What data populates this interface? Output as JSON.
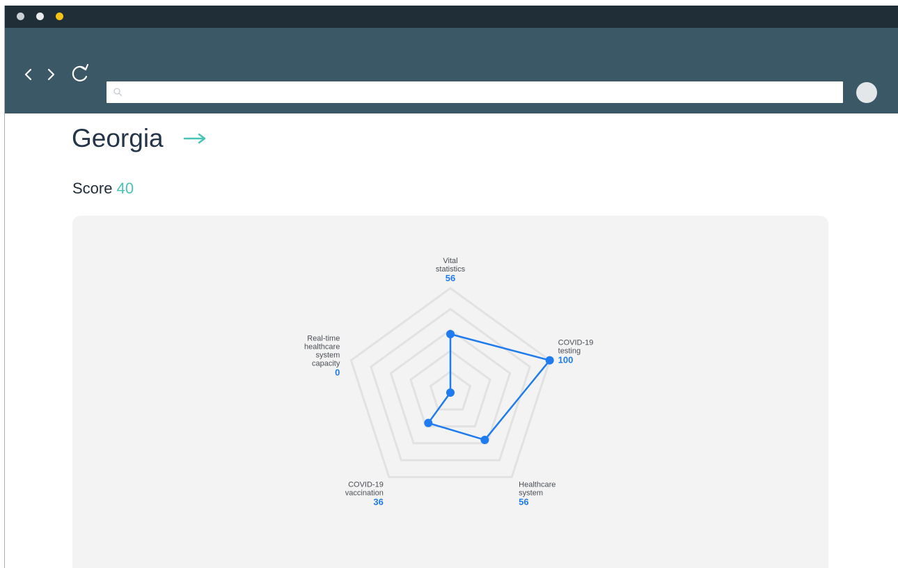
{
  "browser": {
    "window_dots": [
      {
        "color": "#c9cfd2"
      },
      {
        "color": "#e8ecee"
      },
      {
        "color": "#f6c218"
      }
    ],
    "nav": {
      "back_icon": "chevron-left-icon",
      "forward_icon": "chevron-right-icon",
      "reload_icon": "reload-icon",
      "profile_icon": "profile-circle-icon"
    },
    "address_bar": {
      "value": "",
      "placeholder": "",
      "icon": "search-icon"
    }
  },
  "page": {
    "title": "Georgia",
    "title_icon": "arrow-right-icon",
    "score_label": "Score",
    "score_value": "40"
  },
  "colors": {
    "titlebar": "#1f2e37",
    "navbar": "#3a5865",
    "accent_teal": "#48c3b6",
    "series_blue": "#1e7bf0",
    "panel_bg": "#f3f3f3"
  },
  "chart_data": {
    "type": "radar",
    "title": "",
    "max": 100,
    "rings": 5,
    "axes": [
      {
        "label_lines": [
          "Vital",
          "statistics"
        ],
        "value": 56,
        "value_text": "56"
      },
      {
        "label_lines": [
          "COVID-19",
          "testing"
        ],
        "value": 100,
        "value_text": "100"
      },
      {
        "label_lines": [
          "Healthcare",
          "system"
        ],
        "value": 56,
        "value_text": "56"
      },
      {
        "label_lines": [
          "COVID-19",
          "vaccination"
        ],
        "value": 36,
        "value_text": "36"
      },
      {
        "label_lines": [
          "Real-time",
          "healthcare",
          "system",
          "capacity"
        ],
        "value": 0,
        "value_text": "0"
      }
    ],
    "series": [
      {
        "values": [
          56,
          100,
          56,
          36,
          0
        ],
        "color": "#1e7bf0"
      }
    ]
  }
}
